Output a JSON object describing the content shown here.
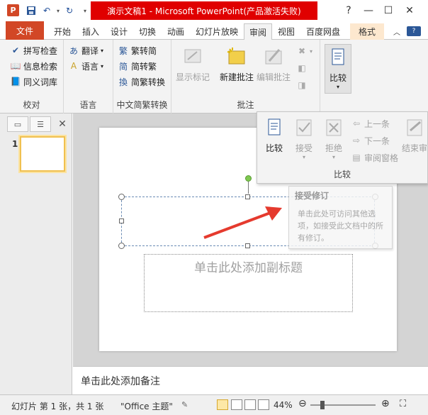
{
  "titlebar": {
    "app_letter": "P",
    "title": "演示文稿1 - Microsoft PowerPoint(产品激活失败)",
    "help": "?",
    "minimize": "—",
    "maximize": "☐",
    "close": "✕",
    "accent_color": "#e00000"
  },
  "tabs": [
    {
      "label": "文件"
    },
    {
      "label": "开始"
    },
    {
      "label": "插入"
    },
    {
      "label": "设计"
    },
    {
      "label": "切换"
    },
    {
      "label": "动画"
    },
    {
      "label": "幻灯片放映"
    },
    {
      "label": "审阅"
    },
    {
      "label": "视图"
    },
    {
      "label": "百度网盘"
    },
    {
      "label": "格式"
    }
  ],
  "ribbon": {
    "proofing": {
      "label": "校对",
      "items": [
        "拼写检查",
        "信息检索",
        "同义词库"
      ]
    },
    "language": {
      "label": "语言",
      "items": [
        "翻译",
        "语言"
      ]
    },
    "chinese": {
      "label": "中文简繁转换",
      "items": [
        "繁转简",
        "简转繁",
        "简繁转换"
      ]
    },
    "comments": {
      "label": "批注",
      "show": "显示标记",
      "new": "新建批注",
      "edit": "编辑批注"
    },
    "compare": {
      "label": "比较",
      "button": "比较"
    }
  },
  "popup": {
    "compare": "比较",
    "accept": "接受",
    "reject": "拒绝",
    "prev": "上一条",
    "next": "下一条",
    "pane": "审阅窗格",
    "end": "结束审",
    "label": "比较"
  },
  "tooltip": {
    "title": "接受修订",
    "body": "单击此处可访问其他选项，如接受此文档中的所有修订。"
  },
  "leftpane": {
    "slide_number": "1",
    "close": "✕"
  },
  "slide": {
    "subtitle_placeholder": "单击此处添加副标题"
  },
  "notes": {
    "placeholder": "单击此处添加备注"
  },
  "status": {
    "slide_info": "幻灯片 第 1 张，共 1 张",
    "theme": "\"Office 主题\"",
    "zoom": "44%",
    "zoom_fraction": 0.44
  }
}
